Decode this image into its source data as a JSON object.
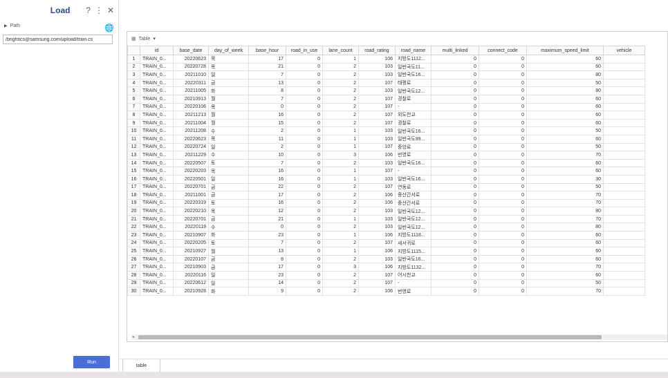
{
  "panel": {
    "title": "Load",
    "help_icon": "help-icon",
    "more_icon": "more-icon",
    "close_icon": "close-icon",
    "path_label": "Path",
    "path_value": "/brightics@samsung.com/upload/train.cs",
    "run_label": "Run"
  },
  "table": {
    "view_label": "Table",
    "tab_label": "table",
    "columns": [
      "",
      "id",
      "base_date",
      "day_of_week",
      "base_hour",
      "road_in_use",
      "lane_count",
      "road_rating",
      "road_name",
      "multi_linked",
      "connect_code",
      "maximum_speed_limit",
      "vehicle"
    ],
    "rows": [
      [
        "1",
        "TRAIN_0...",
        "20220623",
        "목",
        "17",
        "0",
        "1",
        "106",
        "지방도1112...",
        "0",
        "0",
        "60",
        ""
      ],
      [
        "2",
        "TRAIN_0...",
        "20220728",
        "목",
        "21",
        "0",
        "2",
        "103",
        "일반국도11...",
        "0",
        "0",
        "60",
        ""
      ],
      [
        "3",
        "TRAIN_0...",
        "20211010",
        "일",
        "7",
        "0",
        "2",
        "103",
        "일반국도16...",
        "0",
        "0",
        "80",
        ""
      ],
      [
        "4",
        "TRAIN_0...",
        "20220311",
        "금",
        "13",
        "0",
        "2",
        "107",
        "태평로",
        "0",
        "0",
        "50",
        ""
      ],
      [
        "5",
        "TRAIN_0...",
        "20211005",
        "화",
        "8",
        "0",
        "2",
        "103",
        "일반국도12...",
        "0",
        "0",
        "80",
        ""
      ],
      [
        "6",
        "TRAIN_0...",
        "20210913",
        "월",
        "7",
        "0",
        "2",
        "107",
        "경찰로",
        "0",
        "0",
        "60",
        ""
      ],
      [
        "7",
        "TRAIN_0...",
        "20220106",
        "목",
        "0",
        "0",
        "2",
        "107",
        "-",
        "0",
        "0",
        "60",
        ""
      ],
      [
        "8",
        "TRAIN_0...",
        "20211213",
        "월",
        "16",
        "0",
        "2",
        "107",
        "외도천교",
        "0",
        "0",
        "60",
        ""
      ],
      [
        "9",
        "TRAIN_0...",
        "20211004",
        "월",
        "15",
        "0",
        "2",
        "107",
        "경찰로",
        "0",
        "0",
        "60",
        ""
      ],
      [
        "10",
        "TRAIN_0...",
        "20211208",
        "수",
        "2",
        "0",
        "1",
        "103",
        "일반국도16...",
        "0",
        "0",
        "50",
        ""
      ],
      [
        "11",
        "TRAIN_0...",
        "20220623",
        "목",
        "11",
        "0",
        "1",
        "103",
        "일반국도99...",
        "0",
        "0",
        "60",
        ""
      ],
      [
        "12",
        "TRAIN_0...",
        "20220724",
        "일",
        "2",
        "0",
        "1",
        "107",
        "중앙로",
        "0",
        "0",
        "50",
        ""
      ],
      [
        "13",
        "TRAIN_0...",
        "20211229",
        "수",
        "10",
        "0",
        "3",
        "106",
        "번영로",
        "0",
        "0",
        "70",
        ""
      ],
      [
        "14",
        "TRAIN_0...",
        "20220507",
        "토",
        "7",
        "0",
        "2",
        "103",
        "일반국도16...",
        "0",
        "0",
        "60",
        ""
      ],
      [
        "15",
        "TRAIN_0...",
        "20220203",
        "목",
        "16",
        "0",
        "1",
        "107",
        "-",
        "0",
        "0",
        "60",
        ""
      ],
      [
        "16",
        "TRAIN_0...",
        "20220501",
        "일",
        "16",
        "0",
        "1",
        "103",
        "일반국도16...",
        "0",
        "0",
        "30",
        ""
      ],
      [
        "17",
        "TRAIN_0...",
        "20220701",
        "금",
        "22",
        "0",
        "2",
        "107",
        "연동로",
        "0",
        "0",
        "50",
        ""
      ],
      [
        "18",
        "TRAIN_0...",
        "20211001",
        "금",
        "17",
        "0",
        "2",
        "106",
        "중산간서로",
        "0",
        "0",
        "70",
        ""
      ],
      [
        "19",
        "TRAIN_0...",
        "20220319",
        "토",
        "16",
        "0",
        "2",
        "106",
        "중산간서로",
        "0",
        "0",
        "70",
        ""
      ],
      [
        "20",
        "TRAIN_0...",
        "20220210",
        "목",
        "12",
        "0",
        "2",
        "103",
        "일반국도12...",
        "0",
        "0",
        "80",
        ""
      ],
      [
        "21",
        "TRAIN_0...",
        "20220701",
        "금",
        "21",
        "0",
        "1",
        "103",
        "일반국도12...",
        "0",
        "0",
        "70",
        ""
      ],
      [
        "22",
        "TRAIN_0...",
        "20220119",
        "수",
        "0",
        "0",
        "2",
        "103",
        "일반국도12...",
        "0",
        "0",
        "80",
        ""
      ],
      [
        "23",
        "TRAIN_0...",
        "20210907",
        "화",
        "23",
        "0",
        "1",
        "106",
        "지방도1118...",
        "0",
        "0",
        "60",
        ""
      ],
      [
        "24",
        "TRAIN_0...",
        "20220205",
        "토",
        "7",
        "0",
        "2",
        "107",
        "새서귀로",
        "0",
        "0",
        "60",
        ""
      ],
      [
        "25",
        "TRAIN_0...",
        "20210927",
        "월",
        "13",
        "0",
        "1",
        "106",
        "지방도1115...",
        "0",
        "0",
        "60",
        ""
      ],
      [
        "26",
        "TRAIN_0...",
        "20220107",
        "금",
        "8",
        "0",
        "2",
        "103",
        "일반국도16...",
        "0",
        "0",
        "60",
        ""
      ],
      [
        "27",
        "TRAIN_0...",
        "20210903",
        "금",
        "17",
        "0",
        "3",
        "106",
        "지방도1132...",
        "0",
        "0",
        "70",
        ""
      ],
      [
        "28",
        "TRAIN_0...",
        "20220116",
        "일",
        "23",
        "0",
        "2",
        "107",
        "어시천교",
        "0",
        "0",
        "60",
        ""
      ],
      [
        "29",
        "TRAIN_0...",
        "20220612",
        "일",
        "14",
        "0",
        "2",
        "107",
        "-",
        "0",
        "0",
        "50",
        ""
      ],
      [
        "30",
        "TRAIN_0...",
        "20210928",
        "화",
        "9",
        "0",
        "2",
        "106",
        "번영로",
        "0",
        "0",
        "70",
        ""
      ]
    ]
  }
}
